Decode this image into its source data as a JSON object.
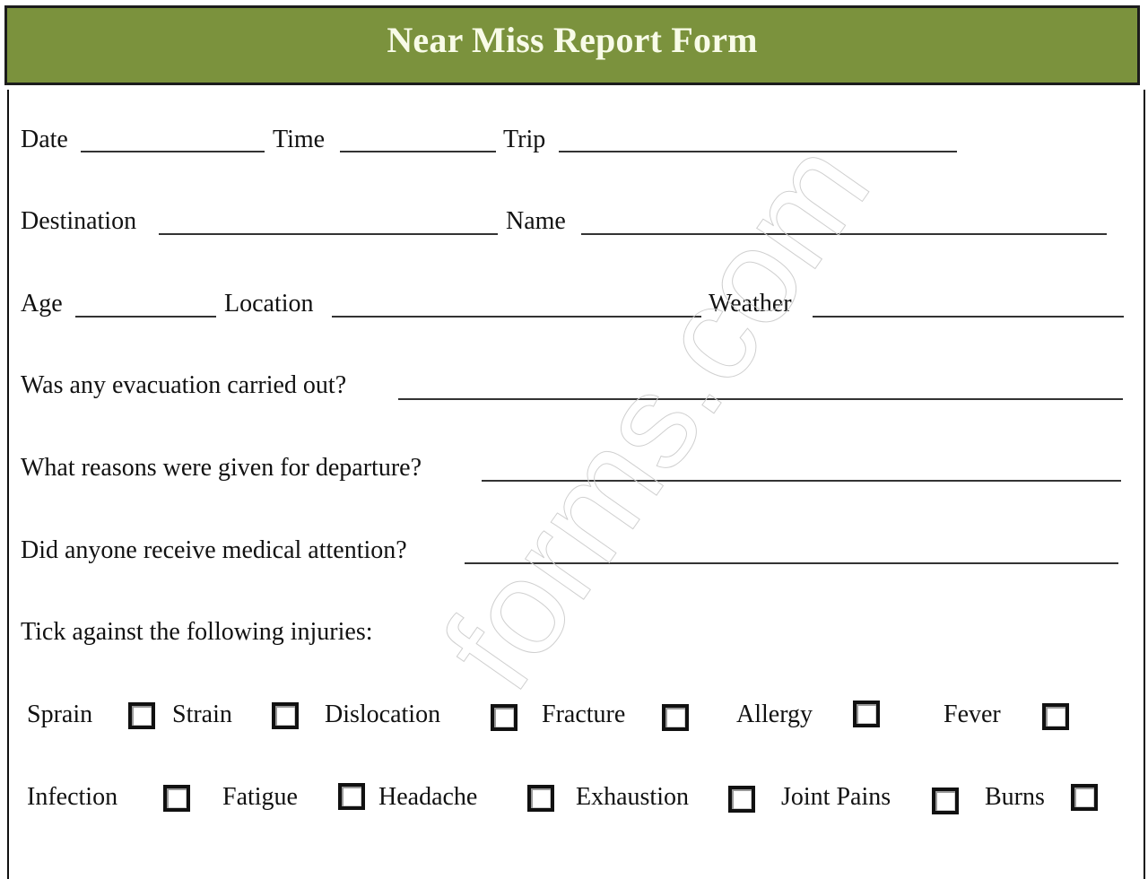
{
  "title": "Near Miss Report Form",
  "colors": {
    "header_bg": "#7b923d",
    "header_text": "#f8fbe8"
  },
  "fields": {
    "date": {
      "label": "Date",
      "value": ""
    },
    "time": {
      "label": "Time",
      "value": ""
    },
    "trip": {
      "label": "Trip",
      "value": ""
    },
    "destination": {
      "label": "Destination",
      "value": ""
    },
    "name": {
      "label": "Name",
      "value": ""
    },
    "age": {
      "label": "Age",
      "value": ""
    },
    "location": {
      "label": "Location",
      "value": ""
    },
    "weather": {
      "label": "Weather",
      "value": ""
    },
    "evacuation": {
      "label": "Was any evacuation carried out?",
      "value": ""
    },
    "departure": {
      "label": "What reasons were given for departure?",
      "value": ""
    },
    "medical": {
      "label": "Did anyone receive medical attention?",
      "value": ""
    }
  },
  "injuries": {
    "heading": "Tick against the following injuries:",
    "items": [
      {
        "label": "Sprain",
        "checked": false
      },
      {
        "label": "Strain",
        "checked": false
      },
      {
        "label": "Dislocation",
        "checked": false
      },
      {
        "label": "Fracture",
        "checked": false
      },
      {
        "label": "Allergy",
        "checked": false
      },
      {
        "label": "Fever",
        "checked": false
      },
      {
        "label": "Infection",
        "checked": false
      },
      {
        "label": "Fatigue",
        "checked": false
      },
      {
        "label": "Headache",
        "checked": false
      },
      {
        "label": "Exhaustion",
        "checked": false
      },
      {
        "label": "Joint Pains",
        "checked": false
      },
      {
        "label": "Burns",
        "checked": false
      }
    ]
  },
  "watermark": "forms.com"
}
